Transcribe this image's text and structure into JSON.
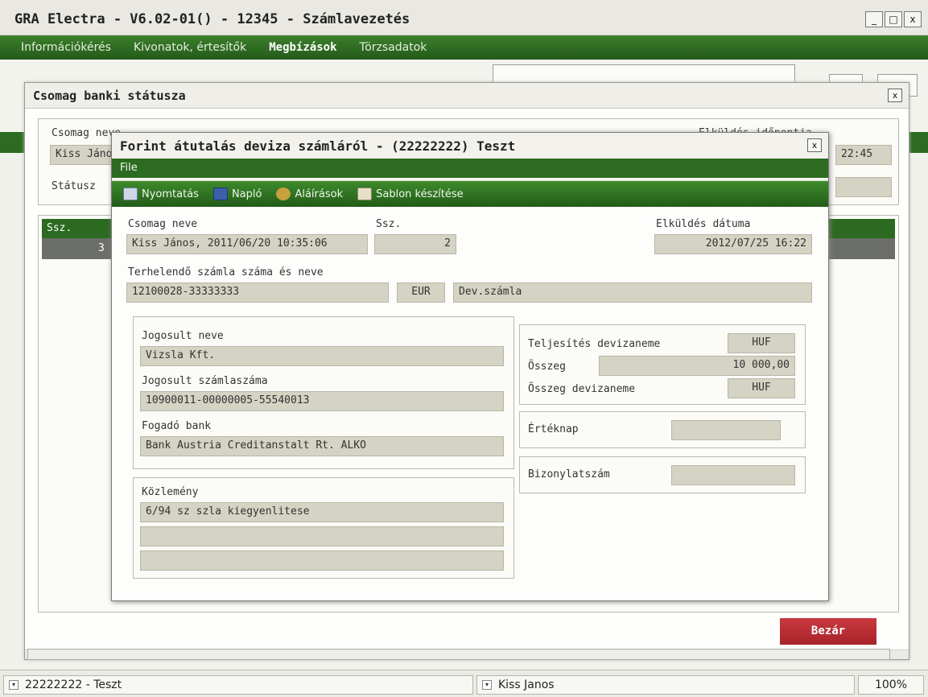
{
  "app": {
    "title": "GRA Electra - V6.02-01() - 12345 - Számlavezetés",
    "window_controls": [
      "_",
      "□",
      "x"
    ]
  },
  "menubar": {
    "items": [
      "Információkérés",
      "Kivonatok, értesítők",
      "Megbízások",
      "Törzsadatok"
    ],
    "active": "Megbízások"
  },
  "outer_dialog": {
    "title": "Csomag banki státusza",
    "close_label": "x",
    "package_name_label": "Csomag neve",
    "package_name_value": "Kiss Jáno",
    "sent_label": "Elküldés időpontja",
    "sent_value": "22:45",
    "status_label": "Státusz",
    "table_header_ssz": "Ssz.",
    "table_row_ssz": "3",
    "close_button": "Bezár"
  },
  "inner_dialog": {
    "title": "Forint átutalás deviza számláról  - (22222222) Teszt",
    "close_label": "x",
    "file_menu": "File",
    "actions": [
      {
        "label": "Nyomtatás",
        "icon": "printer-icon"
      },
      {
        "label": "Napló",
        "icon": "book-icon"
      },
      {
        "label": "Aláírások",
        "icon": "signature-icon"
      },
      {
        "label": "Sablon készítése",
        "icon": "template-icon"
      }
    ],
    "package_name_label": "Csomag neve",
    "package_name_value": "Kiss János, 2011/06/20 10:35:06",
    "ssz_label": "Ssz.",
    "ssz_value": "2",
    "sent_date_label": "Elküldés dátuma",
    "sent_date_value": "2012/07/25 16:22",
    "debit_account_label": "Terhelendő számla száma és neve",
    "debit_account_value": "12100028-33333333",
    "debit_currency": "EUR",
    "debit_account_name": "Dev.számla",
    "beneficiary_name_label": "Jogosult neve",
    "beneficiary_name_value": "Vizsla Kft.",
    "beneficiary_account_label": "Jogosult számlaszáma",
    "beneficiary_account_value": "10900011-00000005-55540013",
    "receiving_bank_label": "Fogadó bank",
    "receiving_bank_value": "Bank Austria Creditanstalt Rt. ALKO",
    "remittance_label": "Közlemény",
    "remittance_lines": [
      "6/94 sz szla kiegyenlitese",
      "",
      ""
    ],
    "settlement_currency_label": "Teljesítés devizaneme",
    "settlement_currency_value": "HUF",
    "amount_label": "Összeg",
    "amount_value": "10 000,00",
    "amount_currency_label": "Összeg devizaneme",
    "amount_currency_value": "HUF",
    "value_date_label": "Értéknap",
    "value_date_value": "",
    "document_number_label": "Bizonylatszám",
    "document_number_value": ""
  },
  "statusbar": {
    "account": "22222222 - Teszt",
    "user": "Kiss Janos",
    "zoom": "100%"
  },
  "colors": {
    "menu_green": "#2c6b21",
    "field_bg": "#d5d3c3",
    "close_red": "#b52b32"
  }
}
